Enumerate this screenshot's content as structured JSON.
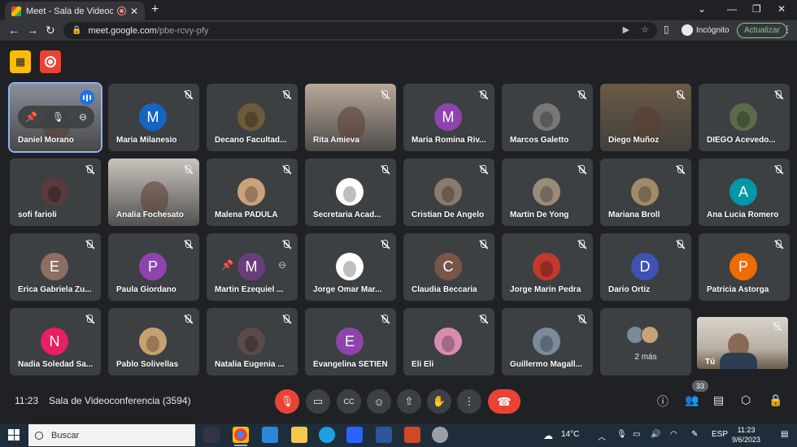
{
  "browser": {
    "tab_title": "Meet - Sala de Videoconfere",
    "url_host": "meet.google.com",
    "url_path": "/pbe-rcvy-pfy",
    "profile_label": "Incógnito",
    "update_label": "Actualizar"
  },
  "participants": [
    {
      "name": "Daniel Morano",
      "type": "video",
      "bg": "#8a8f9a",
      "speaking": true,
      "hover": true
    },
    {
      "name": "Maria Milanesio",
      "type": "letter",
      "letter": "M",
      "color": "#1565c0"
    },
    {
      "name": "Decano Facultad...",
      "type": "photo",
      "color": "#6d5a3a"
    },
    {
      "name": "Rita Amieva",
      "type": "video",
      "bg": "#b8a99a"
    },
    {
      "name": "Maria Romina Riv...",
      "type": "letter",
      "letter": "M",
      "color": "#8e44ad"
    },
    {
      "name": "Marcos Galetto",
      "type": "photo",
      "color": "#777777"
    },
    {
      "name": "Diego Muñoz",
      "type": "video",
      "bg": "#6b5a45"
    },
    {
      "name": "DIEGO Acevedo...",
      "type": "photo",
      "color": "#5b6b4a"
    },
    {
      "name": "sofi farioli",
      "type": "photo",
      "color": "#5a3a3a"
    },
    {
      "name": "Analia Fochesato",
      "type": "video",
      "bg": "#c9c4bd"
    },
    {
      "name": "Malena PADULA",
      "type": "photo",
      "color": "#c9a27a"
    },
    {
      "name": "Secretaria Acad...",
      "type": "photo",
      "color": "#ffffff"
    },
    {
      "name": "Cristian De Angelo",
      "type": "photo",
      "color": "#8a7a6a"
    },
    {
      "name": "Martin De Yong",
      "type": "photo",
      "color": "#9a8a7a"
    },
    {
      "name": "Mariana Broll",
      "type": "photo",
      "color": "#a08a6a"
    },
    {
      "name": "Ana Lucia Romero",
      "type": "letter",
      "letter": "A",
      "color": "#0097a7"
    },
    {
      "name": "Erica Gabriela Zu...",
      "type": "letter",
      "letter": "E",
      "color": "#8d6e63"
    },
    {
      "name": "Paula Giordano",
      "type": "letter",
      "letter": "P",
      "color": "#8e44ad"
    },
    {
      "name": "Martin Ezequiel ...",
      "type": "letter",
      "letter": "M",
      "color": "#6a3d7a",
      "hover": true
    },
    {
      "name": "Jorge Omar Mar...",
      "type": "photo",
      "color": "#ffffff"
    },
    {
      "name": "Claudia Beccaria",
      "type": "letter",
      "letter": "C",
      "color": "#795548"
    },
    {
      "name": "Jorge Marin Pedra",
      "type": "photo",
      "color": "#c0392b"
    },
    {
      "name": "Dario Ortiz",
      "type": "letter",
      "letter": "D",
      "color": "#3f51b5"
    },
    {
      "name": "Patricia Astorga",
      "type": "letter",
      "letter": "P",
      "color": "#ef6c00"
    },
    {
      "name": "Nadia Soledad Sa...",
      "type": "letter",
      "letter": "N",
      "color": "#e91e63"
    },
    {
      "name": "Pablo Solivellas",
      "type": "photo",
      "color": "#c8a070"
    },
    {
      "name": "Natalia Eugenia ...",
      "type": "photo",
      "color": "#5a4a4a"
    },
    {
      "name": "Evangelina SETIEN",
      "type": "letter",
      "letter": "E",
      "color": "#8e44ad"
    },
    {
      "name": "Eli Eli",
      "type": "photo",
      "color": "#d98bb0"
    },
    {
      "name": "Guillermo Magall...",
      "type": "photo",
      "color": "#7a8a9a"
    },
    {
      "name": "",
      "type": "more",
      "label": "2 más"
    },
    {
      "name": "",
      "type": "self"
    }
  ],
  "self_label": "Tú",
  "meeting": {
    "time": "11:23",
    "room": "Sala de Videoconferencia (3594)",
    "participant_count": "33"
  },
  "taskbar": {
    "search_placeholder": "Buscar",
    "weather": "14°C",
    "lang": "ESP",
    "clock_time": "11:23",
    "clock_date": "9/6/2023"
  }
}
